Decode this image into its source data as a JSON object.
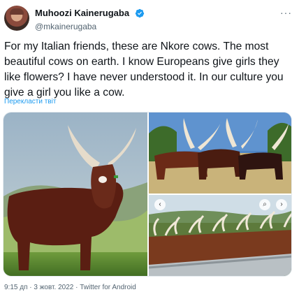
{
  "user": {
    "display_name": "Muhoozi Kainerugaba",
    "handle": "@mkainerugaba",
    "verified": true
  },
  "icons": {
    "verified": "verified-badge-icon",
    "more": "more-options-icon",
    "image_left": "chevron-left-icon",
    "image_search": "lens-search-icon",
    "image_right": "chevron-right-icon"
  },
  "tweet": {
    "more_label": "···",
    "text": "For my Italian friends, these are Nkore cows. The most beautiful cows on earth. I know Europeans give girls they like flowers? I have never understood it. In our culture you give a girl you like a cow.",
    "translate_label": "Перекласти твіт",
    "meta": "9:15 дп · 3 жовт. 2022 · Twitter for Android"
  },
  "media_controls": {
    "left": "‹",
    "search": "⌕",
    "right": "›"
  },
  "colors": {
    "accent": "#1d9bf0",
    "text": "#0f1419",
    "secondary": "#536471"
  }
}
